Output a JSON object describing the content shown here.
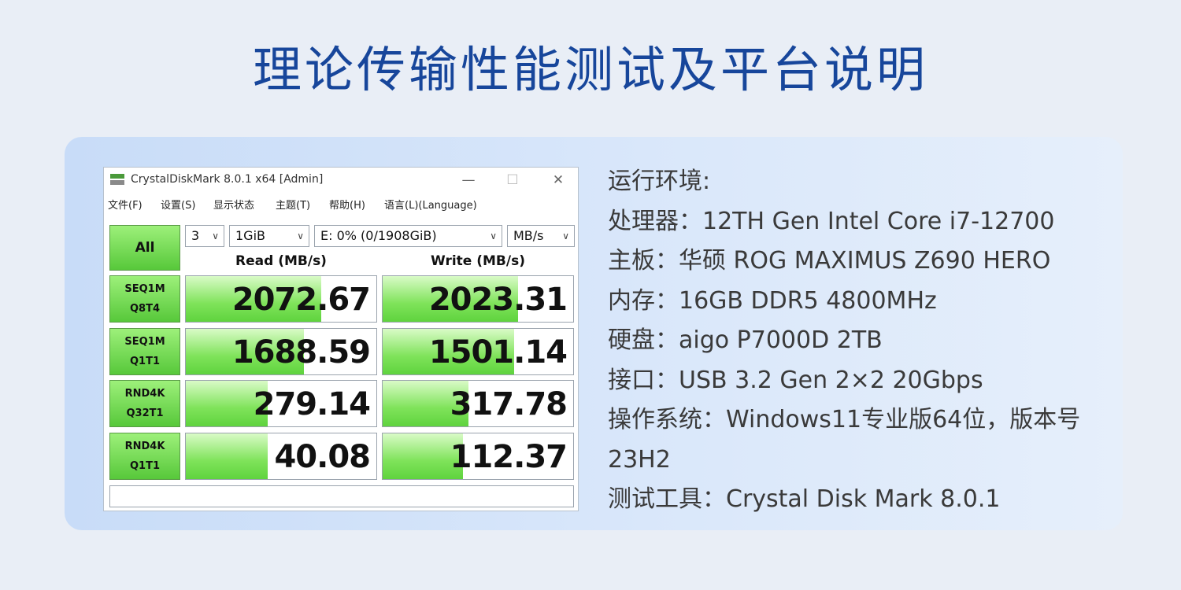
{
  "page": {
    "title": "理论传输性能测试及平台说明"
  },
  "app": {
    "window_title": "CrystalDiskMark 8.0.1 x64 [Admin]",
    "window_buttons": [
      "—",
      "☐",
      "✕"
    ],
    "menu": [
      "文件(F)",
      "设置(S)",
      "显示状态",
      "主题(T)",
      "帮助(H)",
      "语言(L)(Language)"
    ],
    "all_label": "All",
    "controls": {
      "count": "3",
      "size": "1GiB",
      "drive": "E: 0% (0/1908GiB)",
      "unit": "MB/s"
    },
    "columns": {
      "read": "Read (MB/s)",
      "write": "Write (MB/s)"
    },
    "tests": [
      {
        "line1": "SEQ1M",
        "line2": "Q8T4",
        "read": "2072.67",
        "write": "2023.31",
        "read_fill": 0.71,
        "write_fill": 0.71
      },
      {
        "line1": "SEQ1M",
        "line2": "Q1T1",
        "read": "1688.59",
        "write": "1501.14",
        "read_fill": 0.62,
        "write_fill": 0.69
      },
      {
        "line1": "RND4K",
        "line2": "Q32T1",
        "read": "279.14",
        "write": "317.78",
        "read_fill": 0.43,
        "write_fill": 0.45
      },
      {
        "line1": "RND4K",
        "line2": "Q1T1",
        "read": "40.08",
        "write": "112.37",
        "read_fill": 0.43,
        "write_fill": 0.42
      }
    ],
    "colors": {
      "green_light": "#d9fbc7",
      "green": "#5fd33e",
      "button_green": "#7fe35a"
    }
  },
  "specs": [
    "运行环境:",
    "处理器：12TH Gen Intel Core i7-12700",
    "主板：华硕 ROG MAXIMUS Z690 HERO",
    "内存：16GB DDR5 4800MHz",
    "硬盘：aigo P7000D 2TB",
    "接口：USB 3.2 Gen 2×2 20Gbps",
    "操作系统：Windows11专业版64位，版本号",
    "23H2",
    "测试工具：Crystal Disk Mark 8.0.1"
  ],
  "theme": {
    "title_color": "#17469b",
    "card_color": "#d3e3f9"
  }
}
